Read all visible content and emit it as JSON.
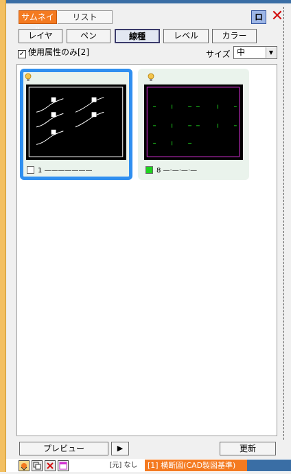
{
  "tabs": {
    "thumbnail": "サムネイル",
    "list": "リスト"
  },
  "window_controls": {
    "pin_icon": "pin-icon",
    "pin_glyph": "ロ",
    "close_icon": "close-icon",
    "close_glyph": "✕"
  },
  "filter_buttons": [
    {
      "label": "レイヤ",
      "active": false
    },
    {
      "label": "ペン",
      "active": false
    },
    {
      "label": "線種",
      "active": true
    },
    {
      "label": "レベル",
      "active": false
    },
    {
      "label": "カラー",
      "active": false
    }
  ],
  "used_attrs": {
    "checked": true,
    "check_glyph": "✓",
    "label": "使用属性のみ[2]"
  },
  "size": {
    "label": "サイズ",
    "value": "中",
    "arrow_glyph": "▼"
  },
  "cards": [
    {
      "label": "1 ———————",
      "selected": true,
      "swatch_color": "#ffffff",
      "bulb_color": "#f3c44b"
    },
    {
      "label": "8 —·—·—·—",
      "selected": false,
      "swatch_color": "#1ed21e",
      "bulb_color": "#f3c44b"
    }
  ],
  "colors": {
    "accent_orange": "#f47a20",
    "selection_blue": "#2f8ff0",
    "frame_magenta": "#d22fd2",
    "dash_green": "#1ed21e"
  },
  "bottom": {
    "preview": "プレビュー",
    "play_glyph": "▶",
    "update": "更新"
  },
  "status": {
    "icons": [
      "import-icon",
      "copy-icon",
      "delete-icon",
      "window-icon"
    ],
    "source": "[元] なし",
    "document": "[1] 横断図(CAD製図基準)"
  }
}
